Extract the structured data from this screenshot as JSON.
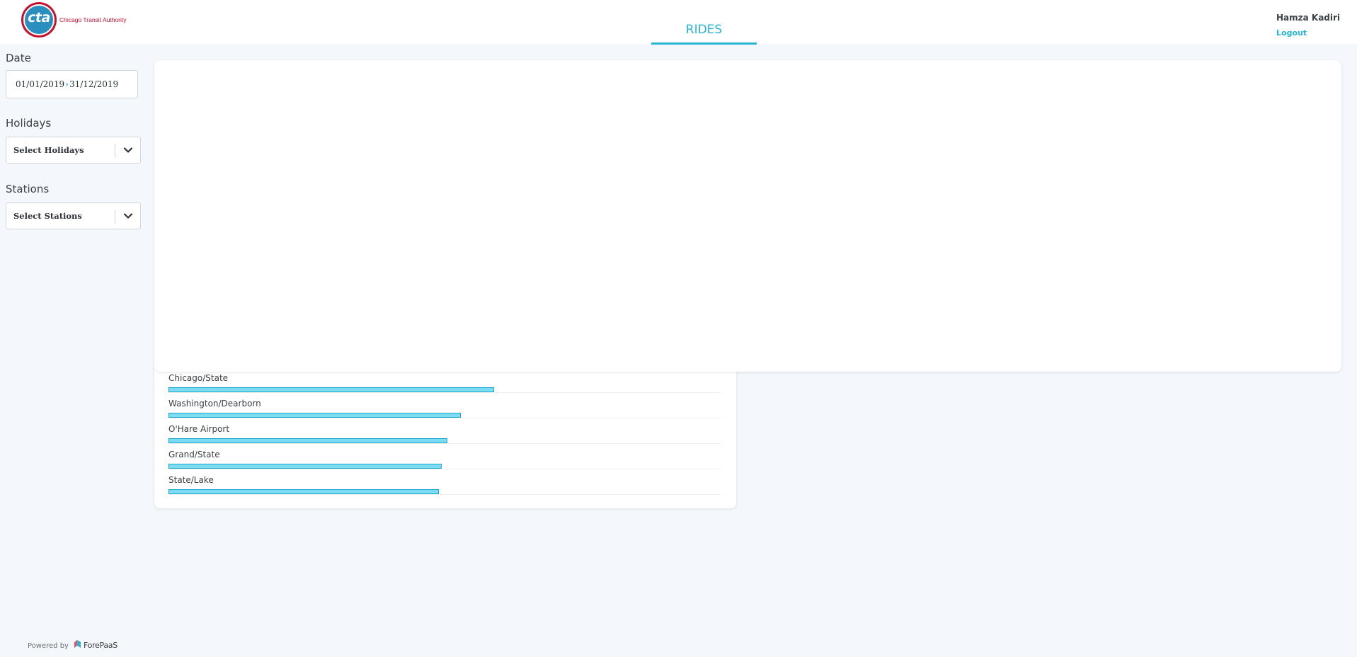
{
  "header": {
    "logo_text": "cta",
    "logo_caption": "Chicago Transit Authority",
    "tab_label": "RIDES",
    "user_name": "Hamza Kadiri",
    "logout_label": "Logout"
  },
  "sidebar": {
    "date_label": "Date",
    "date_start": "01/01/2019",
    "date_end": "31/12/2019",
    "holidays_label": "Holidays",
    "holidays_placeholder": "Select Holidays",
    "stations_label": "Stations",
    "stations_placeholder": "Select Stations"
  },
  "chart_data": {
    "type": "bar",
    "orientation": "horizontal",
    "categories": [
      "Chicago/State",
      "Washington/Dearborn",
      "O'Hare Airport",
      "Grand/State",
      "State/Lake"
    ],
    "values": [
      0.59,
      0.53,
      0.505,
      0.495,
      0.49
    ],
    "xlim": [
      0,
      1
    ],
    "color": "#7ddcf3",
    "border_color": "#1aa7c9"
  },
  "footer": {
    "powered_label": "Powered by",
    "brand": "ForePaaS"
  },
  "colors": {
    "accent": "#27b6d1",
    "brand_red": "#c8102e",
    "brand_blue": "#2a8fbf"
  }
}
